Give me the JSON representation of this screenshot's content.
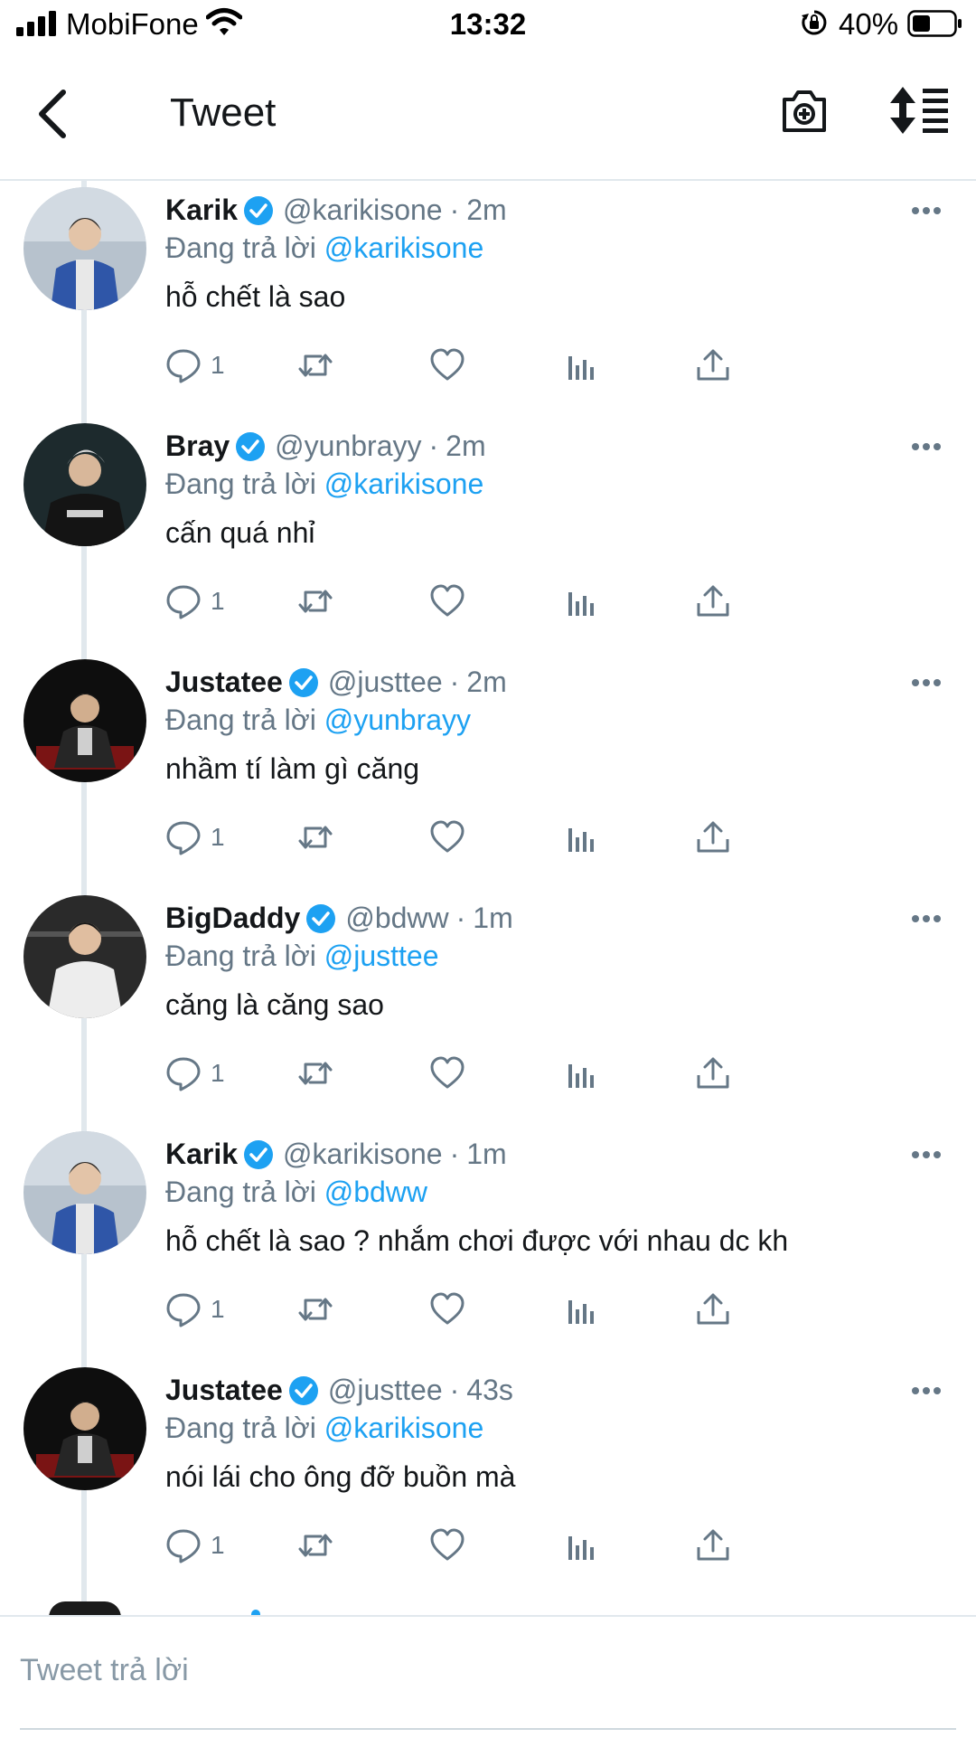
{
  "status_bar": {
    "carrier": "MobiFone",
    "time": "13:32",
    "battery": "40%"
  },
  "header": {
    "title": "Tweet"
  },
  "replies": [
    {
      "name": "Karik",
      "handle": "@karikisone",
      "time": "2m",
      "replying_label": "Đang trả lời",
      "replying_to": "@karikisone",
      "text": "hỗ chết là sao",
      "reply_count": "1"
    },
    {
      "name": "Bray",
      "handle": "@yunbrayy",
      "time": "2m",
      "replying_label": "Đang trả lời",
      "replying_to": "@karikisone",
      "text": "cấn quá nhỉ",
      "reply_count": "1"
    },
    {
      "name": "Justatee",
      "handle": "@justtee",
      "time": "2m",
      "replying_label": "Đang trả lời",
      "replying_to": "@yunbrayy",
      "text": "nhầm tí làm gì căng",
      "reply_count": "1"
    },
    {
      "name": "BigDaddy",
      "handle": "@bdww",
      "time": "1m",
      "replying_label": "Đang trả lời",
      "replying_to": "@justtee",
      "text": "căng là căng sao",
      "reply_count": "1"
    },
    {
      "name": "Karik",
      "handle": "@karikisone",
      "time": "1m",
      "replying_label": "Đang trả lời",
      "replying_to": "@bdww",
      "text": "hỗ chết là sao ? nhắm chơi được với nhau dc kh",
      "reply_count": "1"
    },
    {
      "name": "Justatee",
      "handle": "@justtee",
      "time": "43s",
      "replying_label": "Đang trả lời",
      "replying_to": "@karikisone",
      "text": "nói lái cho ông đỡ buồn mà",
      "reply_count": "1"
    }
  ],
  "compose": {
    "placeholder": "Tweet trả lời"
  },
  "colors": {
    "accent": "#1da1f2",
    "secondary_text": "#657786",
    "divider": "#e1e8ed"
  }
}
